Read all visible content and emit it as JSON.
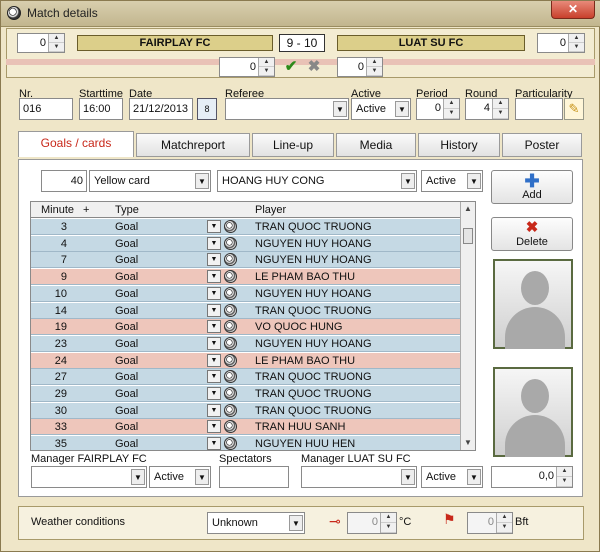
{
  "window": {
    "title": "Match details",
    "close": "✕"
  },
  "header": {
    "home_spin": "0",
    "away_spin": "0",
    "home_team": "FAIRPLAY FC",
    "away_team": "LUAT SU FC",
    "score": "9 - 10",
    "home_extra": "0",
    "away_extra": "0"
  },
  "info": {
    "nr_label": "Nr.",
    "nr": "016",
    "starttime_label": "Starttime",
    "starttime": "16:00",
    "date_label": "Date",
    "date": "21/12/2013",
    "referee_label": "Referee",
    "referee": "",
    "active_label": "Active",
    "active": "Active",
    "period_label": "Period",
    "period": "0",
    "round_label": "Round",
    "round": "4",
    "particularity_label": "Particularity"
  },
  "tabs": [
    "Goals / cards",
    "Matchreport",
    "Line-up",
    "Media",
    "History",
    "Poster"
  ],
  "filter": {
    "minute": "40",
    "type": "Yellow card",
    "player": "HOANG HUY CONG",
    "status": "Active"
  },
  "grid": {
    "headers": {
      "minute": "Minute",
      "plus": "+",
      "type": "Type",
      "player": "Player"
    },
    "rows": [
      {
        "minute": "3",
        "type": "Goal",
        "player": "TRAN QUOC TRUONG",
        "color": "#c5d9e4"
      },
      {
        "minute": "4",
        "type": "Goal",
        "player": "NGUYEN HUY HOANG",
        "color": "#c5d9e4"
      },
      {
        "minute": "7",
        "type": "Goal",
        "player": "NGUYEN HUY HOANG",
        "color": "#c5d9e4"
      },
      {
        "minute": "9",
        "type": "Goal",
        "player": "LE PHAM BAO THU",
        "color": "#eec6bb"
      },
      {
        "minute": "10",
        "type": "Goal",
        "player": "NGUYEN HUY HOANG",
        "color": "#c5d9e4"
      },
      {
        "minute": "14",
        "type": "Goal",
        "player": "TRAN QUOC TRUONG",
        "color": "#c5d9e4"
      },
      {
        "minute": "19",
        "type": "Goal",
        "player": "VO QUOC HUNG",
        "color": "#eec6bb"
      },
      {
        "minute": "23",
        "type": "Goal",
        "player": "NGUYEN HUY HOANG",
        "color": "#c5d9e4"
      },
      {
        "minute": "24",
        "type": "Goal",
        "player": "LE PHAM BAO THU",
        "color": "#eec6bb"
      },
      {
        "minute": "27",
        "type": "Goal",
        "player": "TRAN QUOC TRUONG",
        "color": "#c5d9e4"
      },
      {
        "minute": "29",
        "type": "Goal",
        "player": "TRAN QUOC TRUONG",
        "color": "#c5d9e4"
      },
      {
        "minute": "30",
        "type": "Goal",
        "player": "TRAN QUOC TRUONG",
        "color": "#c5d9e4"
      },
      {
        "minute": "33",
        "type": "Goal",
        "player": "TRAN HUU SANH",
        "color": "#eec6bb"
      },
      {
        "minute": "35",
        "type": "Goal",
        "player": "NGUYEN HUU HEN",
        "color": "#c5d9e4"
      }
    ]
  },
  "side": {
    "add": "Add",
    "delete": "Delete",
    "value": "0,0"
  },
  "managers": {
    "home_label": "Manager FAIRPLAY FC",
    "home_status": "Active",
    "spectators_label": "Spectators",
    "away_label": "Manager LUAT SU FC",
    "away_status": "Active"
  },
  "weather": {
    "label": "Weather conditions",
    "condition": "Unknown",
    "temp": "0",
    "temp_unit": "°C",
    "wind": "0",
    "wind_unit": "Bft"
  }
}
